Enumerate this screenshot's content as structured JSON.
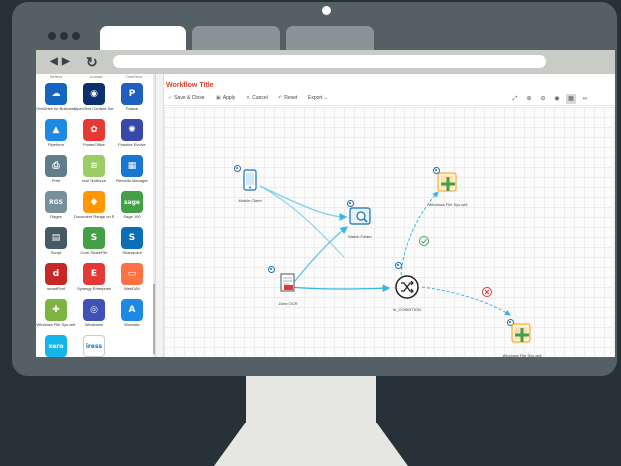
{
  "browser": {
    "tabs": [
      {
        "label": ""
      },
      {
        "label": ""
      },
      {
        "label": ""
      }
    ],
    "nav": {
      "back": "◀",
      "forward": "▶",
      "reload": "↻"
    }
  },
  "sidebar": {
    "top_labels": [
      "Writers",
      "Unload",
      "OneDrive"
    ],
    "items": [
      {
        "label": "OneDrive for Business",
        "icon": "onedrive-icon",
        "glyph": "☁",
        "color": "#1565c0"
      },
      {
        "label": "OpenText Content Server",
        "icon": "opentext-icon",
        "glyph": "◉",
        "color": "#0d2f6e"
      },
      {
        "label": "Palace",
        "icon": "palace-icon",
        "glyph": "P",
        "color": "#1f5fbf"
      },
      {
        "label": "Pipeform",
        "icon": "pipeform-icon",
        "glyph": "▲",
        "color": "#1e88e5"
      },
      {
        "label": "PowerOffice",
        "icon": "poweroffice-icon",
        "glyph": "✿",
        "color": "#e53935"
      },
      {
        "label": "Practice Evolve",
        "icon": "practice-evolve-icon",
        "glyph": "✺",
        "color": "#3949ab"
      },
      {
        "label": "Print",
        "icon": "print-icon",
        "glyph": "⎙",
        "color": "#607d8b"
      },
      {
        "label": "real Textforce",
        "icon": "textforce-icon",
        "glyph": "≋",
        "color": "#9ccc65"
      },
      {
        "label": "Records Manager",
        "icon": "records-manager-icon",
        "glyph": "▦",
        "color": "#1976d2"
      },
      {
        "label": "Rages",
        "icon": "rages-icon",
        "glyph": "RGS",
        "color": "#78909c"
      },
      {
        "label": "Document Range on Repository",
        "icon": "document-range-icon",
        "glyph": "◆",
        "color": "#ff9800"
      },
      {
        "label": "Sage 100",
        "icon": "sage-icon",
        "glyph": "sage",
        "color": "#43a047"
      },
      {
        "label": "Script",
        "icon": "script-icon",
        "glyph": "▤",
        "color": "#455a64"
      },
      {
        "label": "Core ShareFile",
        "icon": "sharefile-icon",
        "glyph": "S",
        "color": "#43a047"
      },
      {
        "label": "Sharepoint",
        "icon": "sharepoint-icon",
        "glyph": "S",
        "color": "#0b6fb8"
      },
      {
        "label": "smartFind",
        "icon": "smartfind-icon",
        "glyph": "d",
        "color": "#c62828"
      },
      {
        "label": "Synergy Enterprise",
        "icon": "synergy-icon",
        "glyph": "E",
        "color": "#e53935"
      },
      {
        "label": "WebDAV",
        "icon": "webdav-icon",
        "glyph": "▭",
        "color": "#ff7043"
      },
      {
        "label": "Windows File Sys writ",
        "icon": "windows-file-system-icon",
        "glyph": "✚",
        "color": "#7cb342"
      },
      {
        "label": "Windream",
        "icon": "windream-icon",
        "glyph": "◎",
        "color": "#3f51b5"
      },
      {
        "label": "Worksite",
        "icon": "worksite-icon",
        "glyph": "A",
        "color": "#1e88e5"
      },
      {
        "label": "",
        "icon": "xero-icon",
        "glyph": "xero",
        "color": "#13b5ea"
      },
      {
        "label": "",
        "icon": "iress-icon",
        "glyph": "iress",
        "color": "#ffffff"
      }
    ]
  },
  "workflow": {
    "title": "Workflow Title",
    "toolbar": {
      "save_close": "Save & Close",
      "apply": "Apply",
      "cancel": "Cancel",
      "reset": "Reset",
      "export": "Export"
    },
    "nodes": {
      "mobile": "Mobile Client",
      "watch": "Watch Folder",
      "zone": "Zone OCR",
      "condition": "in_CONDITION",
      "writer_top": "Windows File Sys writ",
      "writer_bottom": "Windows File Sys writ"
    }
  }
}
